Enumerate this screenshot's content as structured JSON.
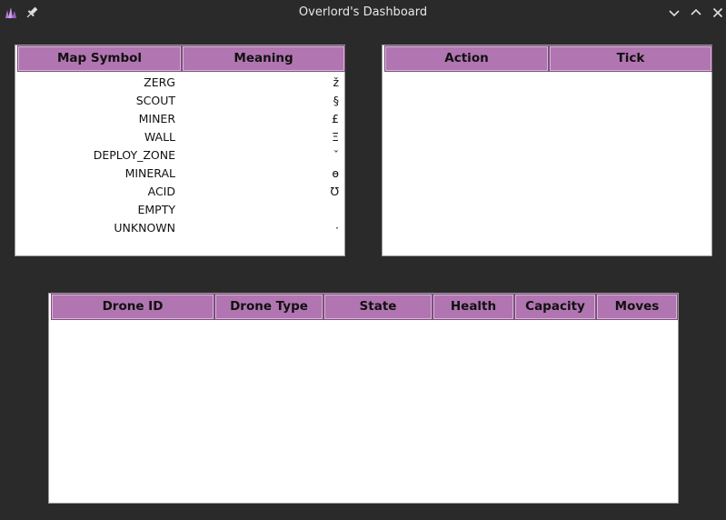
{
  "window": {
    "title": "Overlord's Dashboard",
    "app_icon": "crystal-icon",
    "pin_icon": "pin-icon",
    "controls": [
      "minimize-icon",
      "maximize-icon",
      "close-icon"
    ]
  },
  "symbols_table": {
    "headers": [
      "Map Symbol",
      "Meaning"
    ],
    "rows": [
      {
        "name": "ZERG",
        "meaning": "ž"
      },
      {
        "name": "SCOUT",
        "meaning": "§"
      },
      {
        "name": "MINER",
        "meaning": "£"
      },
      {
        "name": "WALL",
        "meaning": "Ξ"
      },
      {
        "name": "DEPLOY_ZONE",
        "meaning": "ˇ"
      },
      {
        "name": "MINERAL",
        "meaning": "ɵ"
      },
      {
        "name": "ACID",
        "meaning": "Ʊ"
      },
      {
        "name": "EMPTY",
        "meaning": ""
      },
      {
        "name": "UNKNOWN",
        "meaning": "·"
      }
    ]
  },
  "actions_table": {
    "headers": [
      "Action",
      "Tick"
    ],
    "rows": []
  },
  "drones_table": {
    "headers": [
      "Drone ID",
      "Drone Type",
      "State",
      "Health",
      "Capacity",
      "Moves"
    ],
    "rows": []
  },
  "colors": {
    "header_bg": "#b175b1",
    "window_bg": "#2b2a2b",
    "panel_bg": "#ffffff"
  }
}
